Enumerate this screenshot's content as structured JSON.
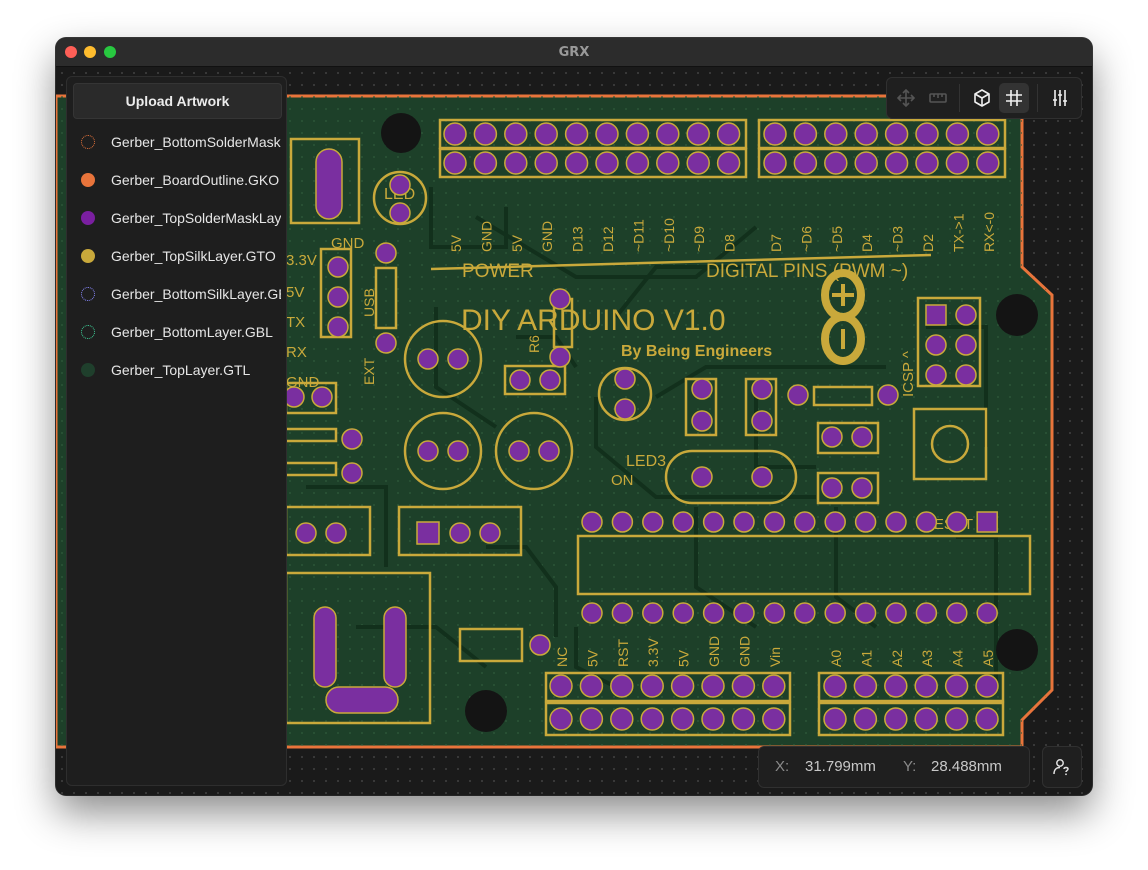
{
  "window": {
    "title": "GRX"
  },
  "colors": {
    "board_outline": "#e8743b",
    "copper": "#1d3d2a",
    "silk": "#c9a93b",
    "solder_mask": "#7a2fa0"
  },
  "sidebar": {
    "upload_label": "Upload Artwork",
    "layers": [
      {
        "name": "Gerber_BottomSolderMask.GBS",
        "color": "#e8743b",
        "style": "dotted"
      },
      {
        "name": "Gerber_BoardOutline.GKO",
        "color": "#e8743b",
        "style": "solid"
      },
      {
        "name": "Gerber_TopSolderMaskLayer.GTS",
        "color": "#7a1fa0",
        "style": "solid"
      },
      {
        "name": "Gerber_TopSilkLayer.GTO",
        "color": "#c9a93b",
        "style": "solid"
      },
      {
        "name": "Gerber_BottomSilkLayer.GBO",
        "color": "#8a8aff",
        "style": "dotted"
      },
      {
        "name": "Gerber_BottomLayer.GBL",
        "color": "#3fd39b",
        "style": "dotted"
      },
      {
        "name": "Gerber_TopLayer.GTL",
        "color": "#1f3f2c",
        "style": "solid"
      }
    ]
  },
  "toolbar": {
    "buttons": [
      {
        "icon": "move-icon",
        "active": false
      },
      {
        "icon": "ruler-icon",
        "active": false
      },
      {
        "icon": "cube-icon",
        "active": true
      },
      {
        "icon": "grid-icon",
        "active": true
      },
      {
        "icon": "sliders-icon",
        "active": true
      }
    ]
  },
  "coords": {
    "x_label": "X:",
    "x_value": "31.799mm",
    "y_label": "Y:",
    "y_value": "28.488mm"
  },
  "pcb": {
    "silk_texts": {
      "title": "DIY ARDUINO V1.0",
      "subtitle": "By Being Engineers",
      "power": "POWER",
      "digital": "DIGITAL PINS (PWM ~)",
      "led": "LED",
      "led3": "LED3",
      "on": "ON",
      "reset": "RESET",
      "icsp": "ICSP ^",
      "r6": "R6",
      "gnd_top": "GND",
      "v33": "3.3V",
      "v5": "5V",
      "tx": "TX",
      "rx": "RX",
      "gnd_left": "GND",
      "usb": "USB",
      "ext": "EXT",
      "plus": "+",
      "minus": "-"
    },
    "power_pins_top": [
      "5V",
      "GND",
      "5V",
      "GND",
      "D13",
      "D12",
      "~D11",
      "~D10",
      "~D9",
      "D8"
    ],
    "digital_pins_top": [
      "D7",
      "~D6",
      "~D5",
      "D4",
      "~D3",
      "D2",
      "TX->1",
      "RX<-0"
    ],
    "power_pins_bottom": [
      "NC",
      "5V",
      "RST",
      "3.3V",
      "5V",
      "GND",
      "GND",
      "Vin"
    ],
    "analog_pins_bottom": [
      "A0",
      "A1",
      "A2",
      "A3",
      "A4",
      "A5"
    ]
  }
}
